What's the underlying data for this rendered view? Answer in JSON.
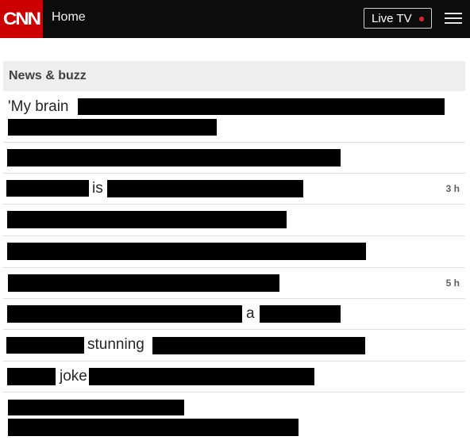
{
  "header": {
    "logo_text": "CNN",
    "home_label": "Home",
    "live_tv_label": "Live TV",
    "accent_color": "#cc0000",
    "live_dot_color": "#e0272b",
    "menu_icon": "hamburger-menu-icon"
  },
  "section": {
    "title": "News & buzz"
  },
  "headlines": [
    {
      "visible_text": [
        "'My brain"
      ]
    },
    {
      "visible_text": []
    },
    {
      "visible_text": [
        "is"
      ],
      "time": "3 h"
    },
    {
      "visible_text": []
    },
    {
      "visible_text": []
    },
    {
      "visible_text": [],
      "time": "5 h"
    },
    {
      "visible_text": [
        "a"
      ]
    },
    {
      "visible_text": [
        "stunning"
      ]
    },
    {
      "visible_text": [
        "joke"
      ]
    },
    {
      "visible_text": []
    }
  ],
  "redaction": "black boxes obscure the rest of each headline"
}
